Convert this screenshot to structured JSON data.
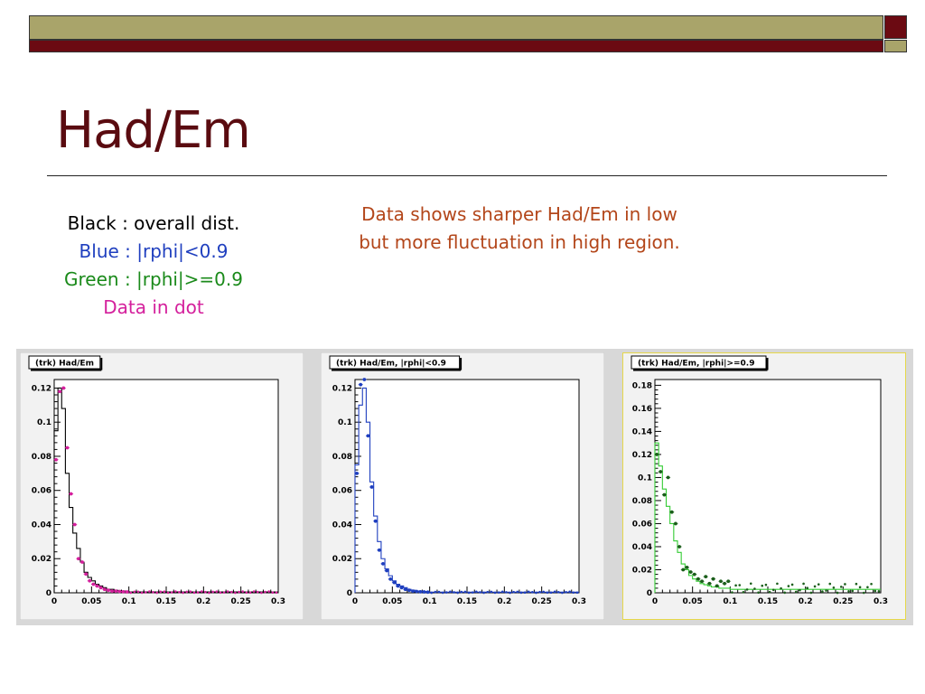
{
  "slide": {
    "title": "Had/Em",
    "legend": [
      {
        "text": "Black : overall dist.",
        "color": "#000000"
      },
      {
        "text": "Blue : |rphi|<0.9",
        "color": "#1f3fbf"
      },
      {
        "text": "Green : |rphi|>=0.9",
        "color": "#1a8a1a"
      },
      {
        "text": "Data in dot",
        "color": "#d4209c"
      }
    ],
    "note_line1": "Data shows sharper Had/Em in low",
    "note_line2": "but more fluctuation in high region.",
    "colors": {
      "band_olive": "#a9a46a",
      "band_maroon": "#6b0a12",
      "title": "#5a0b10",
      "note": "#b3461a"
    }
  },
  "chart_data": [
    {
      "type": "line",
      "title": "(trk) Had/Em",
      "xlim": [
        0,
        0.3
      ],
      "ylim": [
        0,
        0.125
      ],
      "x_ticks": [
        0,
        0.05,
        0.1,
        0.15,
        0.2,
        0.25,
        0.3
      ],
      "x_tick_labels": [
        "0",
        "0.05",
        "0.1",
        "0.15",
        "0.2",
        "0.25",
        "0.3"
      ],
      "y_ticks": [
        0,
        0.02,
        0.04,
        0.06,
        0.08,
        0.1,
        0.12
      ],
      "y_tick_labels": [
        "0",
        "0.02",
        "0.04",
        "0.06",
        "0.08",
        "0.1",
        "0.12"
      ],
      "grid": false,
      "highlighted": false,
      "line_color": "#000000",
      "dot_color": "#d4209c",
      "x": [
        0.0025,
        0.0075,
        0.0125,
        0.0175,
        0.0225,
        0.0275,
        0.0325,
        0.0375,
        0.0425,
        0.0475,
        0.0525,
        0.0575,
        0.0625,
        0.0675,
        0.0725,
        0.0775,
        0.0825,
        0.0875,
        0.0925,
        0.0975
      ],
      "series": [
        {
          "name": "Black : overall dist.",
          "style": "histogram",
          "values": [
            0.095,
            0.12,
            0.108,
            0.07,
            0.05,
            0.035,
            0.026,
            0.018,
            0.012,
            0.009,
            0.007,
            0.005,
            0.004,
            0.003,
            0.002,
            0.002,
            0.0015,
            0.0012,
            0.001,
            0.0008
          ],
          "tail": 0.0005
        },
        {
          "name": "Data in dot",
          "style": "dots",
          "values": [
            0.078,
            0.118,
            0.12,
            0.085,
            0.058,
            0.04,
            0.02,
            0.018,
            0.011,
            0.007,
            0.005,
            0.004,
            0.003,
            0.002,
            0.0015,
            0.001,
            0.001,
            0.0008,
            0.0006,
            0.0005
          ],
          "tail": 0.0005
        }
      ]
    },
    {
      "type": "line",
      "title": "(trk) Had/Em, |rphi|<0.9",
      "xlim": [
        0,
        0.3
      ],
      "ylim": [
        0,
        0.125
      ],
      "x_ticks": [
        0,
        0.05,
        0.1,
        0.15,
        0.2,
        0.25,
        0.3
      ],
      "x_tick_labels": [
        "0",
        "0.05",
        "0.1",
        "0.15",
        "0.2",
        "0.25",
        "0.3"
      ],
      "y_ticks": [
        0,
        0.02,
        0.04,
        0.06,
        0.08,
        0.1,
        0.12
      ],
      "y_tick_labels": [
        "0",
        "0.02",
        "0.04",
        "0.06",
        "0.08",
        "0.1",
        "0.12"
      ],
      "grid": false,
      "highlighted": false,
      "line_color": "#1f3fbf",
      "dot_color": "#1f3fbf",
      "x": [
        0.0025,
        0.0075,
        0.0125,
        0.0175,
        0.0225,
        0.0275,
        0.0325,
        0.0375,
        0.0425,
        0.0475,
        0.0525,
        0.0575,
        0.0625,
        0.0675,
        0.0725,
        0.0775,
        0.0825,
        0.0875,
        0.0925,
        0.0975
      ],
      "series": [
        {
          "name": "Blue : |rphi|<0.9",
          "style": "histogram",
          "values": [
            0.075,
            0.11,
            0.12,
            0.1,
            0.065,
            0.045,
            0.03,
            0.02,
            0.014,
            0.01,
            0.007,
            0.005,
            0.004,
            0.003,
            0.002,
            0.0015,
            0.001,
            0.001,
            0.0008,
            0.0006
          ],
          "tail": 0.0004
        },
        {
          "name": "Data in dot",
          "style": "dots",
          "values": [
            0.07,
            0.122,
            0.125,
            0.092,
            0.062,
            0.042,
            0.025,
            0.017,
            0.013,
            0.008,
            0.006,
            0.004,
            0.003,
            0.002,
            0.0015,
            0.001,
            0.0008,
            0.0006,
            0.0005,
            0.0004
          ],
          "tail": 0.0004
        }
      ]
    },
    {
      "type": "line",
      "title": "(trk) Had/Em, |rphi|>=0.9",
      "xlim": [
        0,
        0.3
      ],
      "ylim": [
        0,
        0.185
      ],
      "x_ticks": [
        0,
        0.05,
        0.1,
        0.15,
        0.2,
        0.25,
        0.3
      ],
      "x_tick_labels": [
        "0",
        "0.05",
        "0.1",
        "0.15",
        "0.2",
        "0.25",
        "0.3"
      ],
      "y_ticks": [
        0,
        0.02,
        0.04,
        0.06,
        0.08,
        0.1,
        0.12,
        0.14,
        0.16,
        0.18
      ],
      "y_tick_labels": [
        "0",
        "0.02",
        "0.04",
        "0.06",
        "0.08",
        "0.1",
        "0.12",
        "0.14",
        "0.16",
        "0.18"
      ],
      "grid": false,
      "highlighted": true,
      "line_color": "#33cc33",
      "dot_color": "#1b5e1b",
      "x": [
        0.0025,
        0.0075,
        0.0125,
        0.0175,
        0.0225,
        0.0275,
        0.0325,
        0.0375,
        0.0425,
        0.0475,
        0.0525,
        0.0575,
        0.0625,
        0.0675,
        0.0725,
        0.0775,
        0.0825,
        0.0875,
        0.0925,
        0.0975
      ],
      "series": [
        {
          "name": "Green : |rphi|>=0.9",
          "style": "histogram",
          "values": [
            0.13,
            0.11,
            0.09,
            0.075,
            0.06,
            0.045,
            0.035,
            0.025,
            0.02,
            0.015,
            0.012,
            0.01,
            0.008,
            0.007,
            0.006,
            0.005,
            0.005,
            0.004,
            0.004,
            0.004
          ],
          "tail": 0.003
        },
        {
          "name": "Data in dot",
          "style": "dots",
          "values": [
            0.12,
            0.105,
            0.085,
            0.1,
            0.07,
            0.06,
            0.04,
            0.02,
            0.022,
            0.018,
            0.016,
            0.012,
            0.01,
            0.014,
            0.008,
            0.012,
            0.006,
            0.01,
            0.008,
            0.01
          ],
          "tail": 0.005
        }
      ]
    }
  ]
}
